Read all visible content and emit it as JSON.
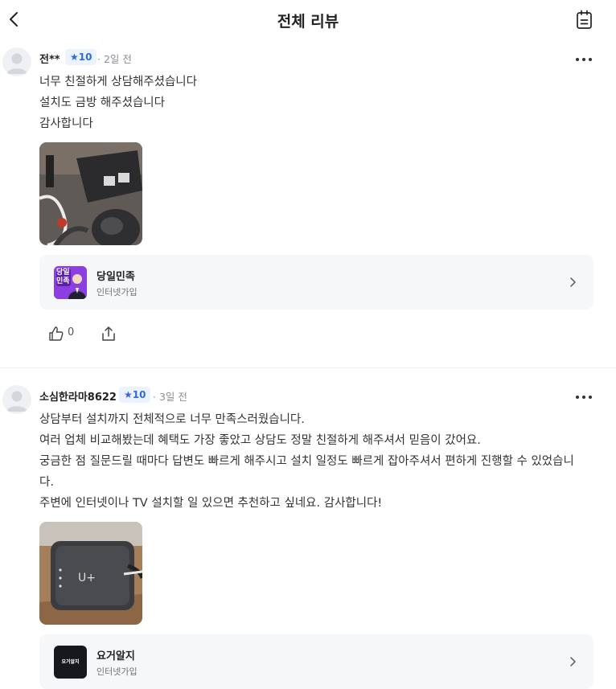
{
  "header": {
    "title": "전체 리뷰",
    "back_icon": "chevron-left-icon",
    "action_icon": "calendar-list-icon"
  },
  "colors": {
    "badge_bg": "#ecf2ff",
    "badge_text": "#2f6bde",
    "card_bg": "#f6f7f9",
    "logo1_bg": "#8b3fe0"
  },
  "reviews": [
    {
      "author": "전**",
      "badge": "10",
      "date": "· 2일 전",
      "lines": [
        "너무 친절하게 상담해주셨습니다",
        "설치도 금방 해주셨습니다",
        "감사합니다"
      ],
      "product": {
        "name": "당일민족",
        "category": "인터넷가입",
        "logo_text_1": "당일",
        "logo_text_2": "민족"
      },
      "likes": "0"
    },
    {
      "author": "소심한라마8622",
      "badge": "10",
      "date": "· 3일 전",
      "lines": [
        "상담부터 설치까지 전체적으로 너무 만족스러웠습니다.",
        "여러 업체 비교해봤는데 혜택도 가장 좋았고 상담도 정말 친절하게 해주셔서 믿음이 갔어요.",
        "궁금한 점 질문드릴 때마다 답변도 빠르게 해주시고 설치 일정도 빠르게 잡아주셔서 편하게 진행할 수 있었습니",
        "다.",
        "주변에 인터넷이나 TV 설치할 일 있으면 추천하고 싶네요. 감사합니다!"
      ],
      "product": {
        "name": "요거알지",
        "category": "인터넷가입",
        "logo_text_1": "요거알지"
      }
    }
  ]
}
